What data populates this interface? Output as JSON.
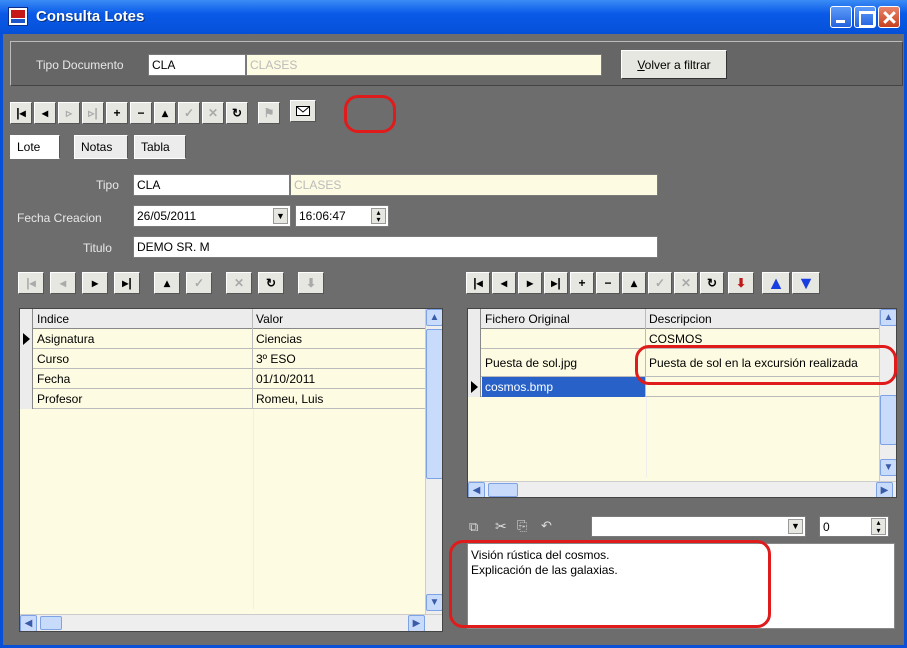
{
  "window": {
    "title": "Consulta Lotes"
  },
  "filter": {
    "tipo_documento_label": "Tipo Documento",
    "tipo_documento_code": "CLA",
    "tipo_documento_desc": "CLASES",
    "volver_label_prefix": "V",
    "volver_label_rest": "olver a filtrar"
  },
  "toolbar_main": {
    "buttons": [
      "first",
      "prior",
      "next",
      "last",
      "insert",
      "delete",
      "edit",
      "post",
      "cancel",
      "refresh",
      "users",
      "mail"
    ]
  },
  "tabs": [
    "Lote",
    "Notas",
    "Tabla"
  ],
  "lote": {
    "tipo_label": "Tipo",
    "tipo_code": "CLA",
    "tipo_desc": "CLASES",
    "fecha_label": "Fecha Creacion",
    "fecha_value": "26/05/2011",
    "hora_value": "16:06:47",
    "titulo_label": "Titulo",
    "titulo_value": "DEMO SR. M"
  },
  "left_grid": {
    "columns": [
      "Indice",
      "Valor"
    ],
    "rows": [
      {
        "indice": "Asignatura",
        "valor": "Ciencias"
      },
      {
        "indice": "Curso",
        "valor": "3º ESO"
      },
      {
        "indice": "Fecha",
        "valor": "01/10/2011"
      },
      {
        "indice": "Profesor",
        "valor": "Romeu, Luis"
      }
    ]
  },
  "right_grid": {
    "columns": [
      "Fichero Original",
      "Descripcion"
    ],
    "rows": [
      {
        "fichero": "",
        "descripcion": "COSMOS"
      },
      {
        "fichero": "Puesta de sol.jpg",
        "descripcion": "Puesta de sol en la excursión realizada"
      },
      {
        "fichero": "cosmos.bmp",
        "descripcion": ""
      }
    ]
  },
  "memo": {
    "line1": "Visión rústica del cosmos.",
    "line2": "Explicación de las galaxias.",
    "font_size_value": "0"
  },
  "colors": {
    "titlebar": "#0a5ae8",
    "panel": "#6d6d6d",
    "readonly": "#fdfbe1",
    "highlight": "#e01b1b",
    "selection": "#2862c8"
  }
}
